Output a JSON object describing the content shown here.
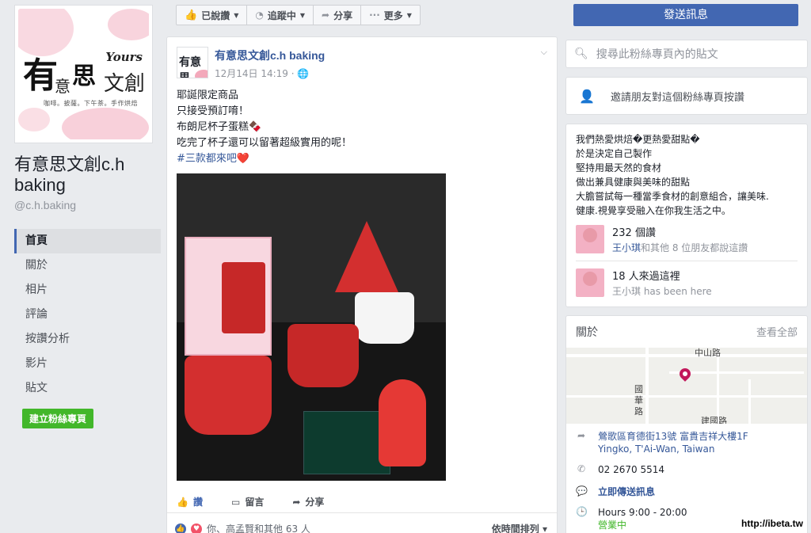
{
  "page": {
    "logo": {
      "yours": "Yours",
      "big1": "有",
      "sm1": "意",
      "big2": "思",
      "sm2": "文創",
      "tagline": "咖啡。披薩。下午茶。手作烘焙"
    },
    "name": "有意思文創c.h baking",
    "handle": "@c.h.baking"
  },
  "nav": {
    "items": [
      "首頁",
      "關於",
      "相片",
      "評論",
      "按讚分析",
      "影片",
      "貼文"
    ],
    "active_index": 0,
    "create_label": "建立粉絲專頁"
  },
  "actionbar": {
    "liked": "已說讚",
    "following": "追蹤中",
    "share": "分享",
    "more": "更多"
  },
  "send_message": "發送訊息",
  "post": {
    "author": "有意思文創c.h baking",
    "time": "12月14日 14:19 · ",
    "lines": [
      "耶誕限定商品",
      "只接受預訂唷！",
      "布朗尼杯子蛋糕🍫",
      "吃完了杯子還可以留著超級實用的呢！"
    ],
    "hashtag": "#三款都來吧❤️",
    "avatar_text": "有意思",
    "actions": {
      "like": "讚",
      "comment": "留言",
      "share": "分享"
    },
    "reactions_text": "你、高孟賢和其他 63 人",
    "sort_label": "依時間排列"
  },
  "sidebar": {
    "search_placeholder": "搜尋此粉絲專頁內的貼文",
    "invite": "邀請朋友對這個粉絲專頁按讚",
    "about_text": [
      "我們熱愛烘焙�更熱愛甜點�",
      "於是決定自己製作",
      "堅持用最天然的食材",
      "做出兼具健康與美味的甜點",
      "大膽嘗試每一種當季食材的創意組合，讓美味.",
      "健康.視覺享受融入在你我生活之中。"
    ],
    "likes": {
      "count": "232 個讚",
      "friend": "王小琪",
      "rest": "和其他 8 位朋友都說這讚"
    },
    "visits": {
      "count": "18 人來過這裡",
      "detail": "王小琪 has been here"
    },
    "about_title": "關於",
    "see_all": "查看全部",
    "map_labels": {
      "road1": "中山路",
      "road2a": "國",
      "road2b": "華",
      "road2c": "路",
      "road3": "建國路"
    },
    "address_line1": "鶯歌區育德街13號 富貴吉祥大樓1F",
    "address_line2": "Yingko, T'Ai-Wan, Taiwan",
    "phone": "02 2670 5514",
    "message": "立即傳送訊息",
    "hours": "Hours 9:00 - 20:00",
    "open": "營業中"
  },
  "watermark": "http://ibeta.tw",
  "colors": {
    "fb_blue": "#4267b2",
    "link": "#365899",
    "green": "#42b72a",
    "bg": "#e9ebee"
  }
}
